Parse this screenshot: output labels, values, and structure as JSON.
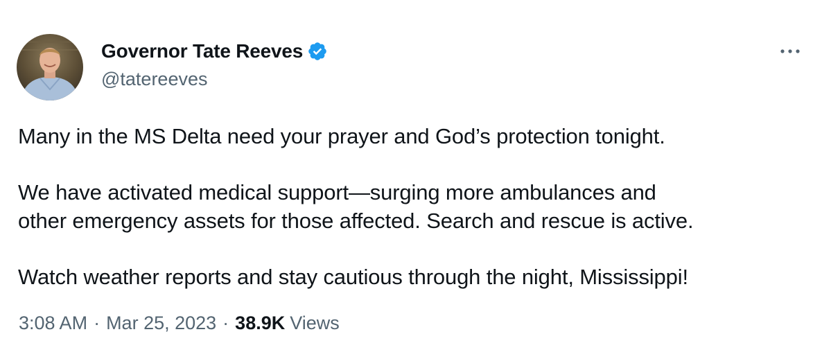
{
  "author": {
    "display_name": "Governor Tate Reeves",
    "handle": "@tatereeves",
    "verified_icon": "verified-badge-icon",
    "avatar": "profile-photo"
  },
  "tweet": {
    "paragraphs": [
      "Many in the MS Delta need your prayer and God’s protection tonight.",
      "We have activated medical support—surging more ambulances and\nother emergency assets for those affected. Search and rescue is active.",
      "Watch weather reports and stay cautious through the night, Mississippi!"
    ]
  },
  "meta": {
    "time": "3:08 AM",
    "separator": "·",
    "date": "Mar 25, 2023",
    "views_count": "38.9K",
    "views_label": "Views"
  },
  "icons": {
    "more": "more-options-icon"
  },
  "colors": {
    "text_primary": "#0f1419",
    "text_secondary": "#536471",
    "verified_blue": "#1d9bf0"
  }
}
